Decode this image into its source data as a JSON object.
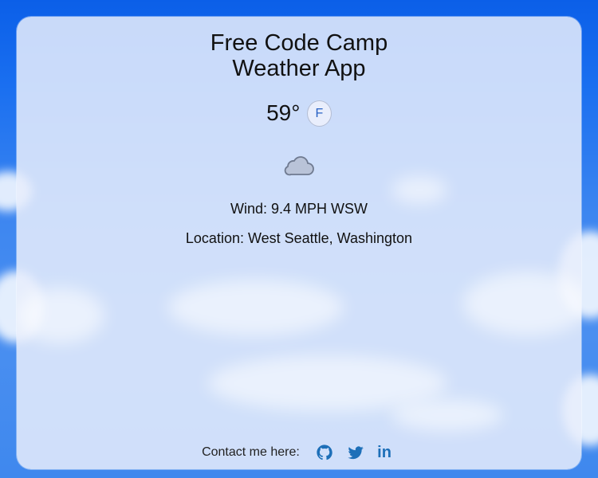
{
  "app": {
    "title_line1": "Free Code Camp",
    "title_line2": "Weather App"
  },
  "weather": {
    "temperature": "59°",
    "unit_toggle": "F",
    "condition_icon": "cloud-icon",
    "wind": "Wind: 9.4 MPH WSW",
    "location": "Location: West Seattle, Washington"
  },
  "footer": {
    "contact_label": "Contact me here:",
    "links": [
      {
        "icon": "github-icon"
      },
      {
        "icon": "twitter-icon"
      },
      {
        "icon": "linkedin-icon",
        "text": "in"
      }
    ]
  },
  "colors": {
    "sky": "#1a6ff0",
    "card": "#e8eefc",
    "accent": "#1d6fb8"
  }
}
